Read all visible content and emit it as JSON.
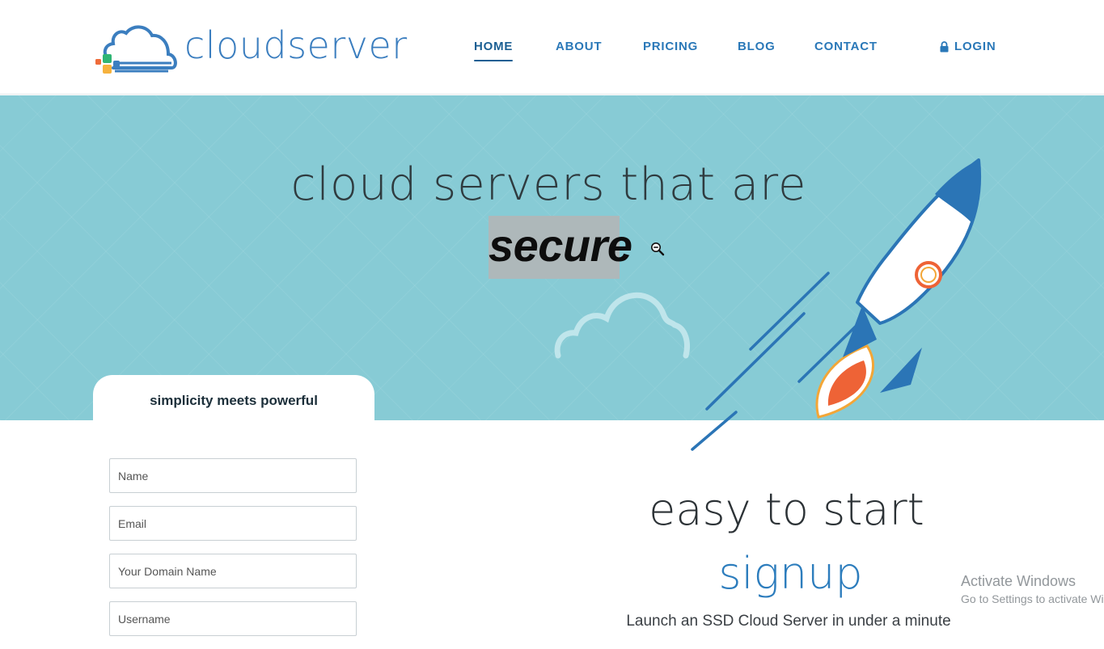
{
  "brand": {
    "name": "cloudserver",
    "accent": "#3b7ebf"
  },
  "nav": {
    "items": [
      {
        "label": "HOME",
        "active": true
      },
      {
        "label": "ABOUT",
        "active": false
      },
      {
        "label": "PRICING",
        "active": false
      },
      {
        "label": "BLOG",
        "active": false
      },
      {
        "label": "CONTACT",
        "active": false
      }
    ],
    "login": {
      "label": "LOGIN",
      "icon": "lock-icon"
    }
  },
  "hero": {
    "title": "cloud servers that are",
    "highlight_word": "secure",
    "background": "#87cbd5",
    "illustration": [
      "cloud-icon",
      "rocket-icon"
    ],
    "cursor": "zoom-out-icon"
  },
  "signup_tab": {
    "label": "simplicity meets powerful"
  },
  "form": {
    "fields": [
      {
        "placeholder": "Name"
      },
      {
        "placeholder": "Email"
      },
      {
        "placeholder": "Your Domain Name"
      },
      {
        "placeholder": "Username"
      }
    ]
  },
  "section": {
    "title": "easy to start",
    "accent": "signup",
    "subtitle": "Launch an SSD Cloud Server in under a minute"
  },
  "watermark": {
    "title": "Activate Windows",
    "subtitle": "Go to Settings to activate Windows."
  }
}
